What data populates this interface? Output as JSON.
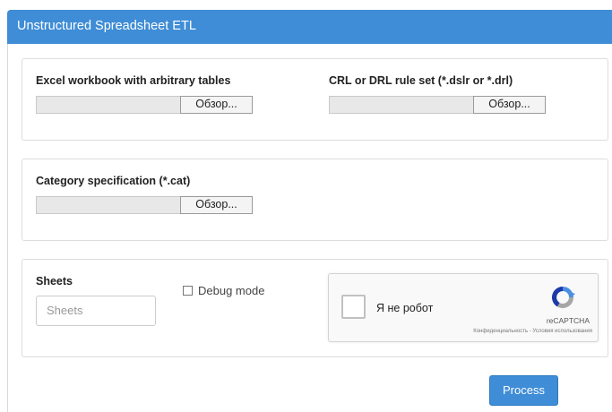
{
  "header": {
    "title": "Unstructured Spreadsheet ETL"
  },
  "workbook": {
    "label": "Excel workbook with arbitrary tables",
    "browse_label": "Обзор..."
  },
  "ruleset": {
    "label": "CRL or DRL rule set (*.dslr or *.drl)",
    "browse_label": "Обзор..."
  },
  "category": {
    "label": "Category specification (*.cat)",
    "browse_label": "Обзор..."
  },
  "sheets": {
    "label": "Sheets",
    "placeholder": "Sheets"
  },
  "debug": {
    "label": "Debug mode",
    "checked": false
  },
  "recaptcha": {
    "checkbox_label": "Я не робот",
    "brand": "reCAPTCHA",
    "links": "Конфиденциальность - Условия использования",
    "logo_icon": "recaptcha-logo-icon"
  },
  "actions": {
    "process_label": "Process"
  },
  "colors": {
    "accent": "#3f8dd6"
  }
}
